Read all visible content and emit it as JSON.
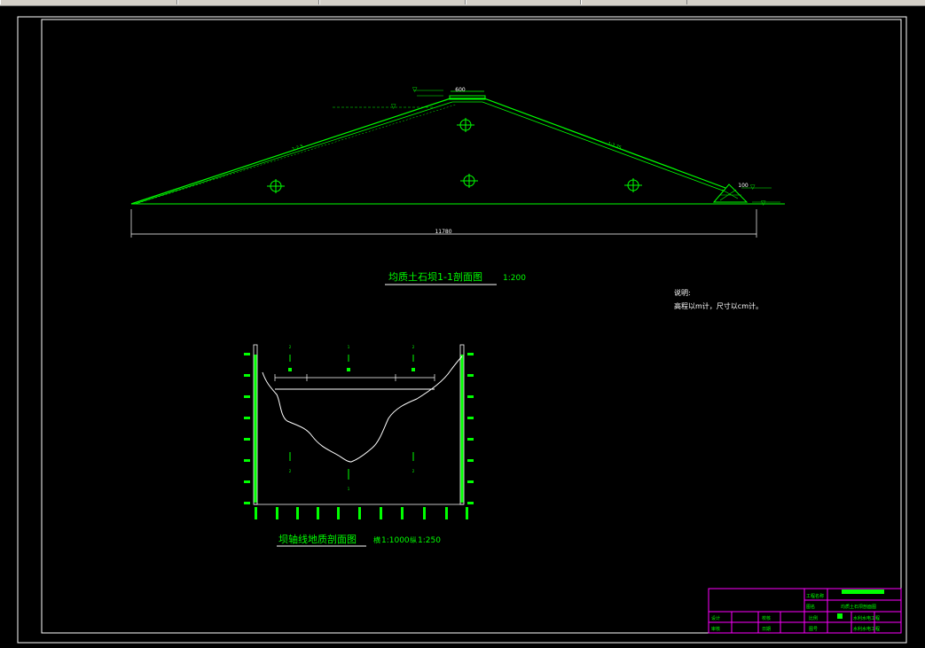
{
  "main_section": {
    "title": "均质土石坝1-1剖面图",
    "scale": "1:200",
    "crest_width": "600",
    "base_width": "11780",
    "toe_dim": "100",
    "up_slope_label": "1:2.5",
    "down_slope_label": "1:2.75",
    "crest_elev": "▽",
    "water_label": "▽"
  },
  "geo_section": {
    "title": "坝轴线地质剖面图",
    "scale_h_prefix": "横",
    "scale_h": "1:1000",
    "scale_v_prefix": "纵",
    "scale_v": "1:250",
    "marks_top": [
      "2",
      "1",
      "2"
    ],
    "marks_bottom": [
      "2",
      "1",
      "2"
    ]
  },
  "notes": {
    "heading": "说明:",
    "line1": "高程以m计，尺寸以cm计。"
  },
  "title_block": {
    "project_label": "工程名称",
    "drawing_label": "图名",
    "drawing_name": "均质土石坝剖面图",
    "design_label": "设计",
    "check_label": "校核",
    "review_label": "审核",
    "scale_label": "比例",
    "date_label": "日期",
    "sheet_label": "图号",
    "drawing_type": "水利水电工程"
  },
  "colors": {
    "background": "#000000",
    "frame": "#ffffff",
    "drawing": "#00ff00",
    "ground": "#ffffff",
    "title_block_border": "#ff00ff"
  }
}
